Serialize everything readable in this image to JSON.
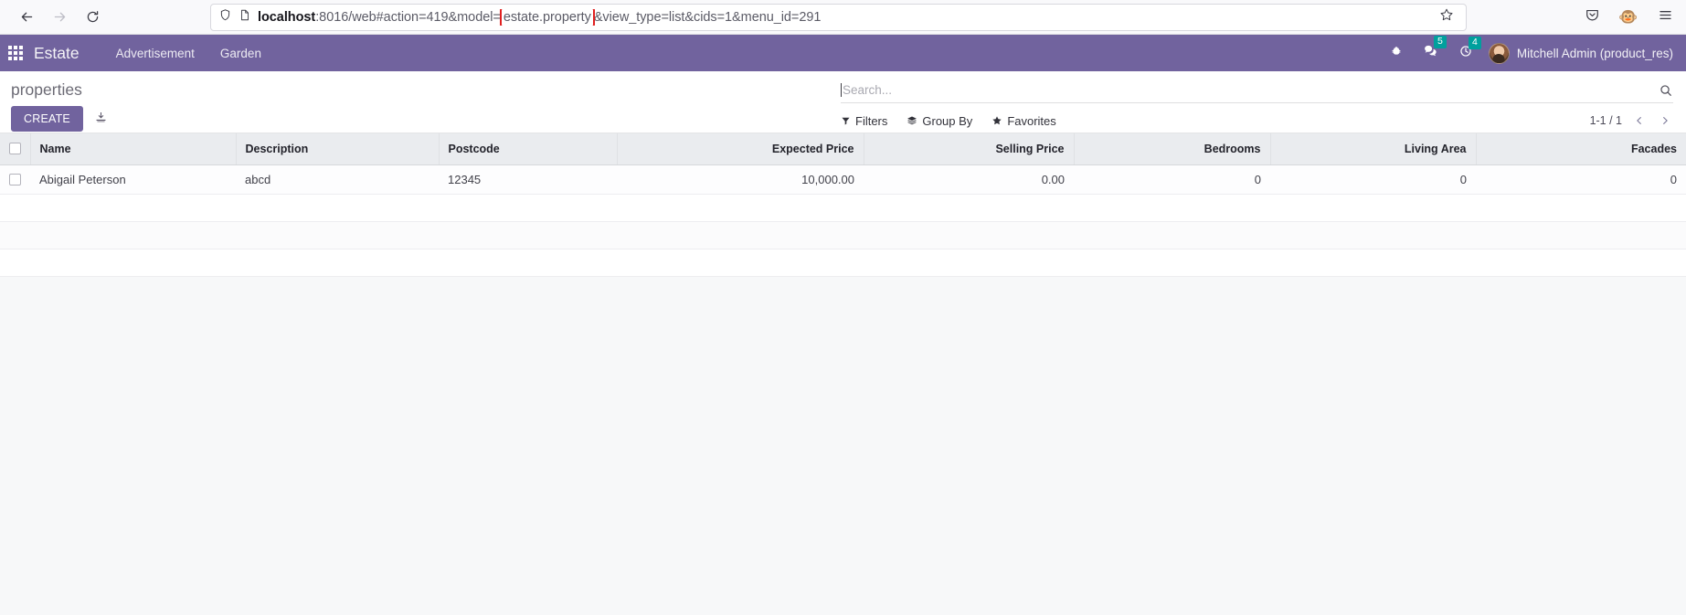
{
  "browser": {
    "back_icon": "back-arrow-icon",
    "forward_icon": "forward-arrow-icon",
    "reload_icon": "reload-icon",
    "shield_icon": "shield-icon",
    "page_icon": "page-icon",
    "star_icon": "bookmark-star-icon",
    "pocket_icon": "pocket-save-icon",
    "extension_icon": "monkey-extension-icon",
    "menu_icon": "hamburger-menu-icon",
    "url": {
      "full": "localhost:8016/web#action=419&model=estate.property&view_type=list&cids=1&menu_id=291",
      "host": "localhost",
      "before_highlight": ":8016/web#action=419&model=",
      "highlight": "estate.property",
      "after_highlight": "&view_type=list&cids=1&menu_id=291",
      "highlight_color": "#e02020"
    }
  },
  "navbar": {
    "apps_icon": "apps-grid-icon",
    "brand": "Estate",
    "menus": [
      {
        "label": "Advertisement"
      },
      {
        "label": "Garden"
      }
    ],
    "bug_icon": "bug-icon",
    "messages_icon": "messages-icon",
    "messages_count": "5",
    "activity_icon": "activity-clock-icon",
    "activity_count": "4",
    "badge_color": "#00a09d",
    "user_name": "Mitchell Admin (product_res)",
    "background_color": "#71639e"
  },
  "control_panel": {
    "title": "properties",
    "create_label": "CREATE",
    "import_icon": "import-download-icon",
    "search": {
      "placeholder": "Search...",
      "value": "",
      "search_icon": "search-icon"
    },
    "filters": [
      {
        "label": "Filters",
        "icon": "filter-funnel-icon"
      },
      {
        "label": "Group By",
        "icon": "group-by-layers-icon"
      },
      {
        "label": "Favorites",
        "icon": "favorites-star-icon"
      }
    ],
    "pager": {
      "text": "1-1 / 1",
      "prev_icon": "chevron-left-icon",
      "next_icon": "chevron-right-icon"
    }
  },
  "list_view": {
    "columns": [
      {
        "label": "Name",
        "align": "txt"
      },
      {
        "label": "Description",
        "align": "txt"
      },
      {
        "label": "Postcode",
        "align": "txt"
      },
      {
        "label": "Expected Price",
        "align": "num"
      },
      {
        "label": "Selling Price",
        "align": "num"
      },
      {
        "label": "Bedrooms",
        "align": "num"
      },
      {
        "label": "Living Area",
        "align": "num"
      },
      {
        "label": "Facades",
        "align": "num"
      }
    ],
    "rows": [
      {
        "name": "Abigail Peterson",
        "description": "abcd",
        "postcode": "12345",
        "expected_price": "10,000.00",
        "selling_price": "0.00",
        "bedrooms": "0",
        "living_area": "0",
        "facades": "0"
      }
    ]
  }
}
